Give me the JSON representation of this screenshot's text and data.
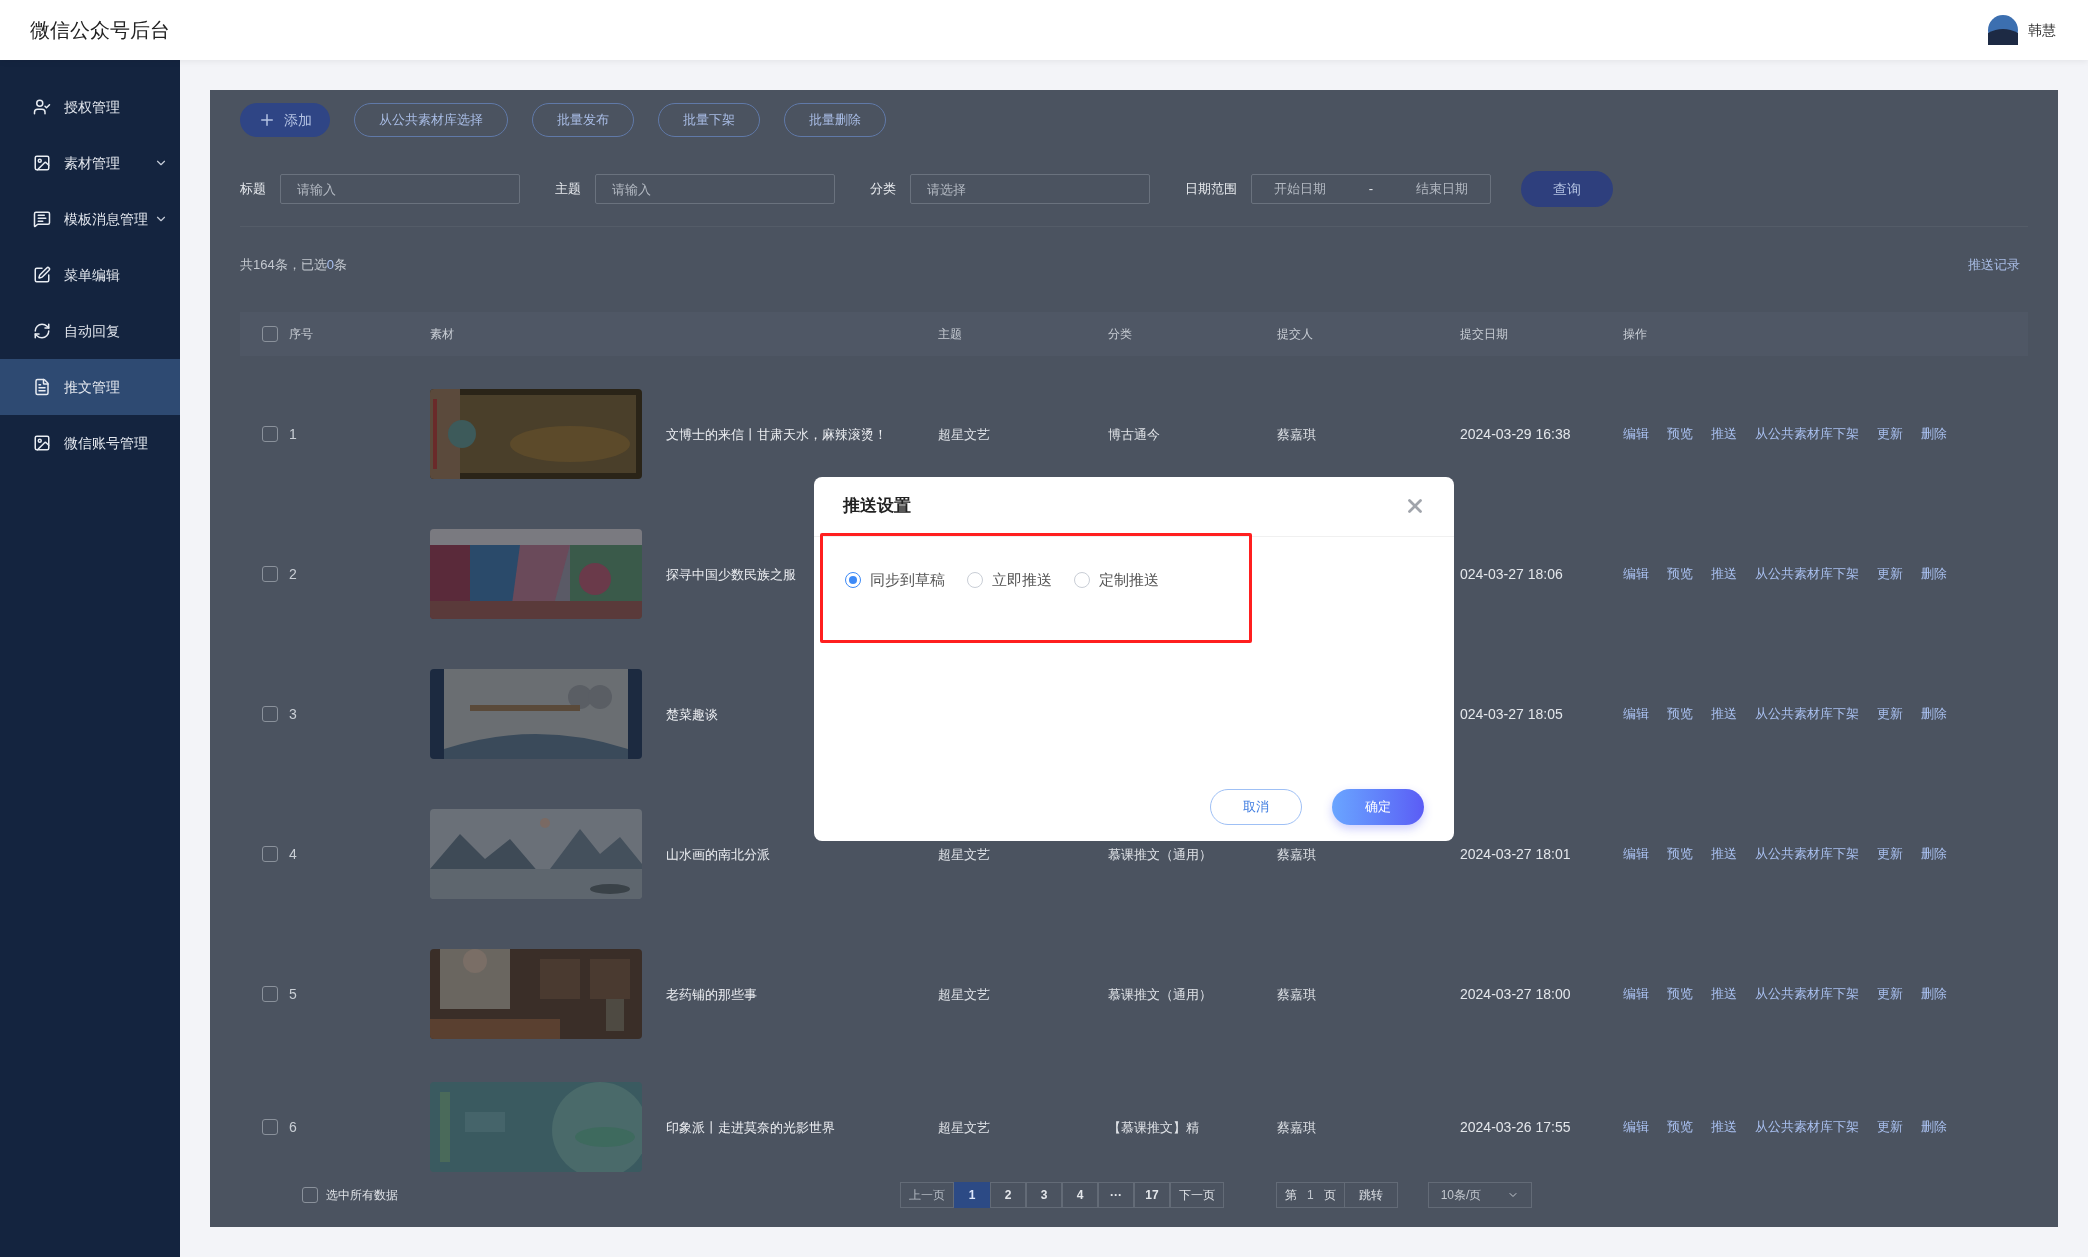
{
  "header": {
    "title": "微信公众号后台",
    "user": "韩慧"
  },
  "sidebar": {
    "items": [
      {
        "label": "授权管理",
        "expandable": false,
        "selected": false
      },
      {
        "label": "素材管理",
        "expandable": true,
        "selected": false
      },
      {
        "label": "模板消息管理",
        "expandable": true,
        "selected": false
      },
      {
        "label": "菜单编辑",
        "expandable": false,
        "selected": false
      },
      {
        "label": "自动回复",
        "expandable": false,
        "selected": false
      },
      {
        "label": "推文管理",
        "expandable": false,
        "selected": true
      },
      {
        "label": "微信账号管理",
        "expandable": false,
        "selected": false
      }
    ]
  },
  "toolbar": {
    "buttons": [
      {
        "label": "添加",
        "kind": "primary"
      },
      {
        "label": "从公共素材库选择",
        "kind": "outline"
      },
      {
        "label": "批量发布",
        "kind": "outline"
      },
      {
        "label": "批量下架",
        "kind": "outline"
      },
      {
        "label": "批量删除",
        "kind": "outline"
      }
    ]
  },
  "filters": [
    {
      "label": "标题",
      "kind": "input",
      "placeholder": "请输入"
    },
    {
      "label": "主题",
      "kind": "input",
      "placeholder": "请输入"
    },
    {
      "label": "分类",
      "kind": "select",
      "placeholder": "请选择"
    },
    {
      "label": "日期范围",
      "kind": "range",
      "start_placeholder": "开始日期",
      "separator": "-",
      "end_placeholder": "结束日期"
    }
  ],
  "search_button": "查询",
  "summary": {
    "prefix": "共164条，已选",
    "count": "0",
    "suffix": "条"
  },
  "push_record_link": "推送记录",
  "table": {
    "header_checked": false,
    "columns": [
      "序号",
      "素材",
      "主题",
      "分类",
      "提交人",
      "提交日期",
      "操作"
    ],
    "rows": [
      {
        "checked": false,
        "index": "1",
        "title": "文博士的来信丨甘肃天水，麻辣滚烫！",
        "theme": "超星文艺",
        "category": "博古通今",
        "submitter": "蔡嘉琪",
        "date": "2024-03-29 16:38",
        "actions": [
          "编辑",
          "预览",
          "推送",
          "从公共素材库下架",
          "更新",
          "删除"
        ]
      },
      {
        "checked": false,
        "index": "2",
        "title": "探寻中国少数民族之服",
        "date": "024-03-27 18:06",
        "actions": [
          "编辑",
          "预览",
          "推送",
          "从公共素材库下架",
          "更新",
          "删除"
        ]
      },
      {
        "checked": false,
        "index": "3",
        "title": "楚菜趣谈",
        "date": "024-03-27 18:05",
        "actions": [
          "编辑",
          "预览",
          "推送",
          "从公共素材库下架",
          "更新",
          "删除"
        ]
      },
      {
        "checked": false,
        "index": "4",
        "title": "山水画的南北分派",
        "theme": "超星文艺",
        "category": "慕课推文（通用）",
        "submitter": "蔡嘉琪",
        "date": "2024-03-27 18:01",
        "actions": [
          "编辑",
          "预览",
          "推送",
          "从公共素材库下架",
          "更新",
          "删除"
        ]
      },
      {
        "checked": false,
        "index": "5",
        "title": "老药铺的那些事",
        "theme": "超星文艺",
        "category": "慕课推文（通用）",
        "submitter": "蔡嘉琪",
        "date": "2024-03-27 18:00",
        "actions": [
          "编辑",
          "预览",
          "推送",
          "从公共素材库下架",
          "更新",
          "删除"
        ]
      },
      {
        "checked": false,
        "index": "6",
        "title": "印象派丨走进莫奈的光影世界",
        "theme": "超星文艺",
        "category": "【慕课推文】精",
        "submitter": "蔡嘉琪",
        "date": "2024-03-26 17:55",
        "actions": [
          "编辑",
          "预览",
          "推送",
          "从公共素材库下架",
          "更新",
          "删除"
        ]
      }
    ]
  },
  "footer": {
    "select_all": {
      "label": "选中所有数据",
      "checked": false
    },
    "pagination": {
      "prev": "上一页",
      "pages": [
        {
          "label": "1",
          "selected": true
        },
        {
          "label": "2",
          "selected": false
        },
        {
          "label": "3",
          "selected": false
        },
        {
          "label": "4",
          "selected": false
        },
        {
          "label": "···",
          "selected": false
        },
        {
          "label": "17",
          "selected": false
        }
      ],
      "next": "下一页",
      "goto_prefix": "第",
      "goto_value": "1",
      "goto_suffix": "页",
      "goto_button": "跳转",
      "page_size": "10条/页"
    }
  },
  "dialog": {
    "title": "推送设置",
    "options": [
      {
        "label": "同步到草稿",
        "selected": true
      },
      {
        "label": "立即推送",
        "selected": false
      },
      {
        "label": "定制推送",
        "selected": false
      }
    ],
    "cancel": "取消",
    "confirm": "确定"
  }
}
